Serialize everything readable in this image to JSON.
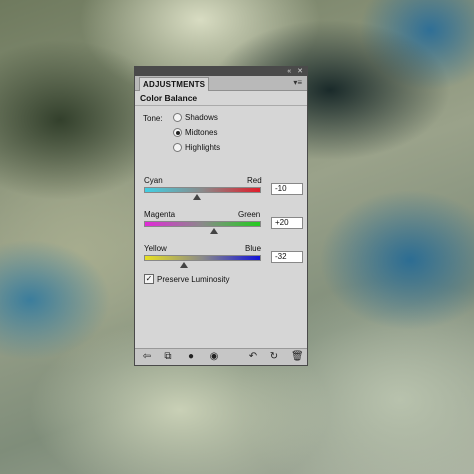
{
  "panel": {
    "tab_label": "ADJUSTMENTS",
    "title": "Color Balance",
    "topbar_icons": [
      "collapse-icon",
      "close-icon"
    ],
    "menu_icon": "panel-menu-icon"
  },
  "tone": {
    "label": "Tone:",
    "options": [
      {
        "label": "Shadows",
        "selected": false
      },
      {
        "label": "Midtones",
        "selected": true
      },
      {
        "label": "Highlights",
        "selected": false
      }
    ]
  },
  "sliders": [
    {
      "left_label": "Cyan",
      "right_label": "Red",
      "value": "-10",
      "level": -10,
      "colors": [
        "#41d0e4",
        "#e11d2a"
      ]
    },
    {
      "left_label": "Magenta",
      "right_label": "Green",
      "value": "+20",
      "level": 20,
      "colors": [
        "#e12ad8",
        "#22cc1e"
      ]
    },
    {
      "left_label": "Yellow",
      "right_label": "Blue",
      "value": "-32",
      "level": -32,
      "colors": [
        "#e8e021",
        "#1212d8"
      ]
    }
  ],
  "preserve": {
    "label": "Preserve Luminosity",
    "checked": true,
    "mark": "✓"
  },
  "toolbar": [
    "return-icon",
    "clip-icon",
    "visibility-icon",
    "eye-icon",
    "previous-state-icon",
    "reset-icon",
    "delete-icon"
  ]
}
